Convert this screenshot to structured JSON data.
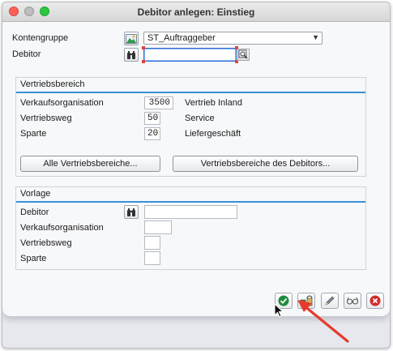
{
  "window": {
    "title": "Debitor anlegen: Einstieg"
  },
  "header": {
    "kontengruppe_label": "Kontengruppe",
    "kontengruppe_value": "ST_Auftraggeber",
    "debitor_label": "Debitor",
    "debitor_value": ""
  },
  "vertriebsbereich": {
    "title": "Vertriebsbereich",
    "rows": [
      {
        "label": "Verkaufsorganisation",
        "value": "3500",
        "text": "Vertrieb Inland"
      },
      {
        "label": "Vertriebsweg",
        "value": "50",
        "text": "Service"
      },
      {
        "label": "Sparte",
        "value": "20",
        "text": "Liefergeschäft"
      }
    ],
    "btn_all": "Alle Vertriebsbereiche...",
    "btn_debitor": "Vertriebsbereiche des Debitors..."
  },
  "vorlage": {
    "title": "Vorlage",
    "debitor_label": "Debitor",
    "vkorg_label": "Verkaufsorganisation",
    "vtweg_label": "Vertriebsweg",
    "sparte_label": "Sparte"
  },
  "toolbar": {
    "icons": [
      "check-icon",
      "org-levels-icon",
      "edit-icon",
      "glasses-icon",
      "cancel-icon"
    ]
  },
  "colors": {
    "accent_line": "#3a8fd6",
    "focus_border": "#2b6fd6",
    "check_green": "#1f8a3b",
    "cancel_red": "#d42a2a",
    "arrow_red": "#e53b2c"
  }
}
